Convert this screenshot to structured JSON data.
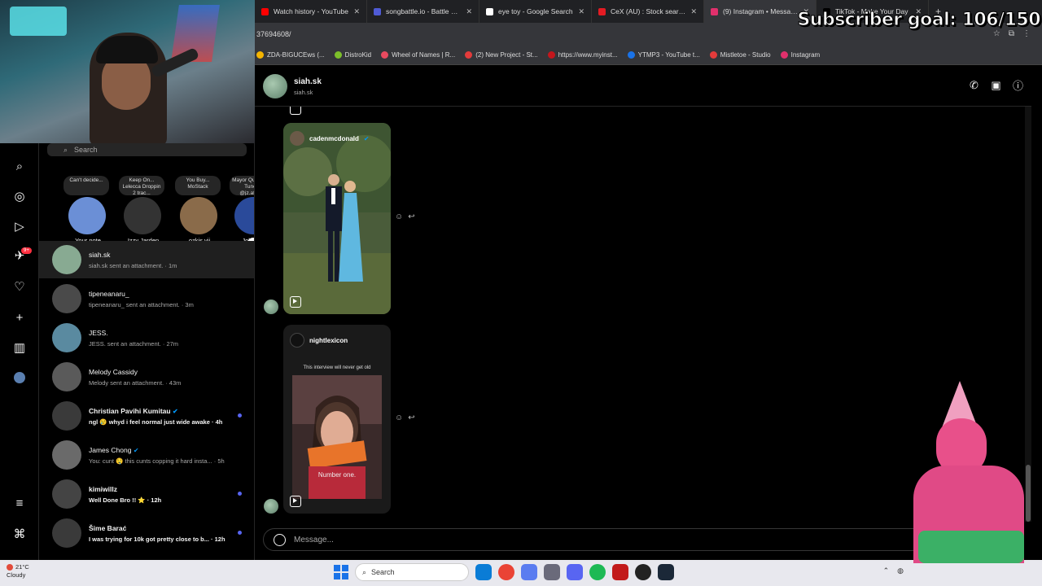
{
  "overlay": {
    "subscriber_goal": "Subscriber goal: 106/150"
  },
  "browser": {
    "tabs": [
      {
        "label": "Watch history - YouTube",
        "color": "#ff0000",
        "active": false
      },
      {
        "label": "songbattle.io - Battle Son",
        "color": "#4f5bd5",
        "active": false
      },
      {
        "label": "eye toy - Google Search",
        "color": "#ffffff",
        "active": false
      },
      {
        "label": "CeX (AU) : Stock search",
        "color": "#e31b23",
        "active": false
      },
      {
        "label": "(9) Instagram • Messages",
        "color": "#e1306c",
        "active": true
      },
      {
        "label": "TikTok - Make Your Day",
        "color": "#000000",
        "active": false
      }
    ],
    "url": "37694608/",
    "bookmarks": [
      {
        "label": "ZDA-BIGUCEws (...",
        "color": "#f4b400"
      },
      {
        "label": "DistroKid",
        "color": "#7cbf2a"
      },
      {
        "label": "Wheel of Names | R...",
        "color": "#e84a5f"
      },
      {
        "label": "(2) New Project - St...",
        "color": "#e33b3b"
      },
      {
        "label": "https://www.myinst...",
        "color": "#c4161c"
      },
      {
        "label": "YTMP3 - YouTube t...",
        "color": "#1a73e8"
      },
      {
        "label": "Mistletoe - Studio",
        "color": "#e33b3b"
      },
      {
        "label": "Instagram",
        "color": "#e1306c"
      }
    ]
  },
  "sidebar": {
    "search_placeholder": "Search",
    "messages_badge": "9+",
    "notes": [
      {
        "text": "Can't decide...",
        "name": "Your note",
        "color": "#6b8fd6"
      },
      {
        "text": "Keep On... Lelecca Droppin 2 trac...",
        "name": "Izzy Jarden",
        "color": "#333333"
      },
      {
        "text": "You Buy... MoStack",
        "name": "ozkis.vii",
        "color": "#8a6b4a"
      },
      {
        "text": "Mayor Qu... Luny Tunes, @jz.afu0...",
        "name": "John Afu",
        "color": "#2a4a9a"
      }
    ],
    "conversations": [
      {
        "name": "siah.sk",
        "preview": "siah.sk sent an attachment. · 1m",
        "verified": false,
        "unread": false,
        "selected": true,
        "color": "#88aa92"
      },
      {
        "name": "tipeneanaru_",
        "preview": "tipeneanaru_ sent an attachment. · 3m",
        "verified": false,
        "unread": false,
        "selected": false,
        "color": "#4a4a4a"
      },
      {
        "name": "JESS.",
        "preview": "JESS. sent an attachment. · 27m",
        "verified": false,
        "unread": false,
        "selected": false,
        "color": "#5a8aa0"
      },
      {
        "name": "Melody Cassidy",
        "preview": "Melody sent an attachment. · 43m",
        "verified": false,
        "unread": false,
        "selected": false,
        "color": "#5a5a5a"
      },
      {
        "name": "Christian Pavihi Kumitau",
        "preview": "ngl 😢 whyd i feel normal just wide awake · 4h",
        "verified": true,
        "unread": true,
        "selected": false,
        "color": "#3a3a3a"
      },
      {
        "name": "James Chong",
        "preview": "You: cunt 🤤 this cunts copping it hard insta... · 5h",
        "verified": true,
        "unread": false,
        "selected": false,
        "color": "#6a6a6a"
      },
      {
        "name": "kimiwillz",
        "preview": "Well Done Bro !! ⭐ · 12h",
        "verified": false,
        "unread": true,
        "selected": false,
        "color": "#444444"
      },
      {
        "name": "Šime Barać",
        "preview": "I was trying for 10k got pretty close to b... · 12h",
        "verified": false,
        "unread": true,
        "selected": false,
        "color": "#3a3a3a"
      }
    ]
  },
  "chat": {
    "name": "siah.sk",
    "username": "siah.sk",
    "posts": [
      {
        "user": "cadenmcdonald",
        "verified": true,
        "caption": ""
      },
      {
        "user": "nightlexicon",
        "verified": false,
        "caption": "This interview will never get old",
        "subtitle": "Number one."
      }
    ],
    "composer_placeholder": "Message..."
  },
  "taskbar": {
    "temp": "21°C",
    "weather": "Cloudy",
    "search_label": "Search"
  }
}
